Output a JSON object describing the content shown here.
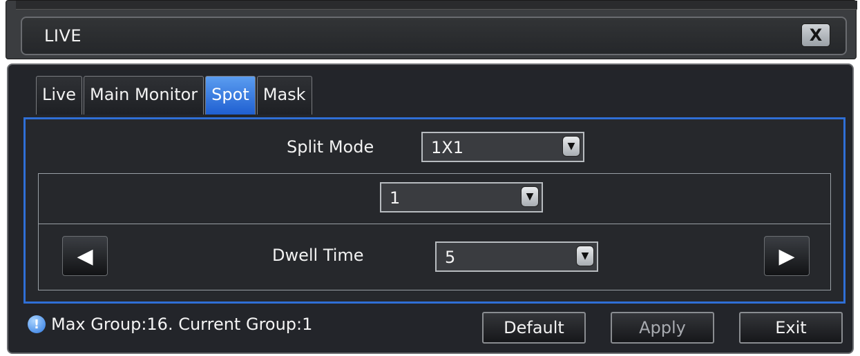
{
  "window": {
    "title": "LIVE",
    "close_label": "X"
  },
  "tabs": [
    {
      "label": "Live",
      "active": false
    },
    {
      "label": "Main Monitor",
      "active": false
    },
    {
      "label": "Spot",
      "active": true
    },
    {
      "label": "Mask",
      "active": false
    }
  ],
  "spot": {
    "split_mode_label": "Split Mode",
    "split_mode_value": "1X1",
    "channel_value": "1",
    "dwell_time_label": "Dwell Time",
    "dwell_time_value": "5",
    "prev_icon": "left-triangle-icon",
    "next_icon": "right-triangle-icon"
  },
  "footer": {
    "info_icon": "info-icon",
    "info_text": "Max Group:16. Current Group:1",
    "default_label": "Default",
    "apply_label": "Apply",
    "exit_label": "Exit"
  },
  "colors": {
    "active_tab": "#2f6fd6",
    "panel_bg": "#23252a"
  }
}
